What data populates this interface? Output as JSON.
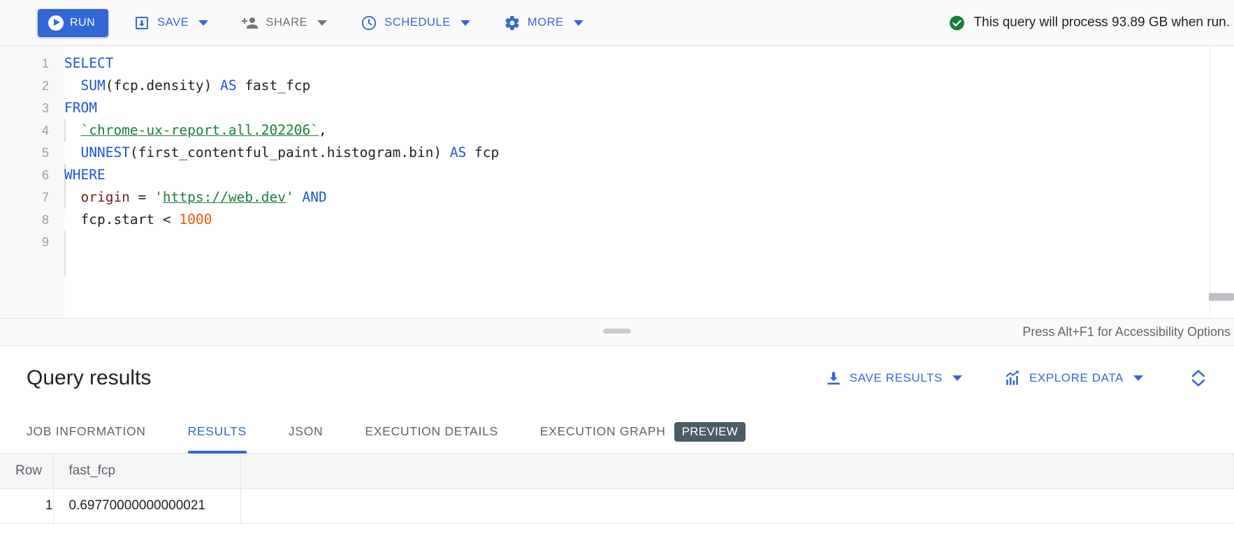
{
  "toolbar": {
    "run_label": "RUN",
    "run_icon": "play-circle-icon",
    "buttons": [
      {
        "label": "SAVE",
        "icon": "save-download-icon",
        "state": "enabled"
      },
      {
        "label": "SHARE",
        "icon": "person-add-icon",
        "state": "disabled"
      },
      {
        "label": "SCHEDULE",
        "icon": "clock-icon",
        "state": "enabled"
      },
      {
        "label": "MORE",
        "icon": "gear-icon",
        "state": "enabled"
      }
    ],
    "status": {
      "icon": "check-circle-icon",
      "text": "This query will process 93.89 GB when run.",
      "color": "#188038"
    }
  },
  "editor": {
    "accessibility_hint": "Press Alt+F1 for Accessibility Options",
    "line_numbers": [
      "1",
      "2",
      "3",
      "4",
      "5",
      "6",
      "7",
      "8",
      "9"
    ],
    "lines": [
      {
        "n": "1",
        "tokens": [
          {
            "t": "SELECT",
            "c": "kw"
          }
        ]
      },
      {
        "n": "2",
        "tokens": [
          {
            "t": "  ",
            "c": ""
          },
          {
            "t": "SUM",
            "c": "kw"
          },
          {
            "t": "(fcp.density) ",
            "c": ""
          },
          {
            "t": "AS",
            "c": "kw"
          },
          {
            "t": " fast_fcp",
            "c": ""
          }
        ]
      },
      {
        "n": "3",
        "tokens": [
          {
            "t": "FROM",
            "c": "kw"
          }
        ]
      },
      {
        "n": "4",
        "tokens": [
          {
            "t": "  ",
            "c": ""
          },
          {
            "t": "`chrome-ux-report.all.202206`",
            "c": "tbl"
          },
          {
            "t": ",",
            "c": ""
          }
        ]
      },
      {
        "n": "5",
        "tokens": [
          {
            "t": "  ",
            "c": ""
          },
          {
            "t": "UNNEST",
            "c": "kw"
          },
          {
            "t": "(first_contentful_paint.histogram.bin) ",
            "c": ""
          },
          {
            "t": "AS",
            "c": "kw"
          },
          {
            "t": " fcp",
            "c": ""
          }
        ]
      },
      {
        "n": "6",
        "tokens": [
          {
            "t": "WHERE",
            "c": "kw"
          }
        ]
      },
      {
        "n": "7",
        "tokens": [
          {
            "t": "  ",
            "c": ""
          },
          {
            "t": "origin",
            "c": "id-red"
          },
          {
            "t": " = ",
            "c": ""
          },
          {
            "t": "'",
            "c": "str"
          },
          {
            "t": "https://web.dev",
            "c": "strlink"
          },
          {
            "t": "'",
            "c": "str"
          },
          {
            "t": " ",
            "c": ""
          },
          {
            "t": "AND",
            "c": "kw"
          }
        ]
      },
      {
        "n": "8",
        "tokens": [
          {
            "t": "  fcp.start < ",
            "c": ""
          },
          {
            "t": "1000",
            "c": "num"
          }
        ]
      },
      {
        "n": "9",
        "tokens": []
      }
    ]
  },
  "results": {
    "title": "Query results",
    "actions": [
      {
        "label": "SAVE RESULTS",
        "icon": "download-icon",
        "has_caret": true
      },
      {
        "label": "EXPLORE DATA",
        "icon": "chart-trend-icon",
        "has_caret": true
      }
    ],
    "expand_icon": "expand-collapse-chevrons-icon",
    "tabs": [
      {
        "label": "JOB INFORMATION",
        "active": false,
        "badge": null
      },
      {
        "label": "RESULTS",
        "active": true,
        "badge": null
      },
      {
        "label": "JSON",
        "active": false,
        "badge": null
      },
      {
        "label": "EXECUTION DETAILS",
        "active": false,
        "badge": null
      },
      {
        "label": "EXECUTION GRAPH",
        "active": false,
        "badge": "PREVIEW"
      }
    ],
    "table": {
      "columns": [
        "Row",
        "fast_fcp",
        ""
      ],
      "rows": [
        {
          "row": "1",
          "fast_fcp": "0.69770000000000021",
          "pad": ""
        }
      ]
    }
  },
  "colors": {
    "accent_blue": "#3367d6",
    "success_green": "#188038",
    "badge_slate": "#4a5c66",
    "keyword_blue": "#1a56d6",
    "string_green": "#188038",
    "number_orange": "#e8590c",
    "identifier_maroon": "#7b1b17"
  }
}
